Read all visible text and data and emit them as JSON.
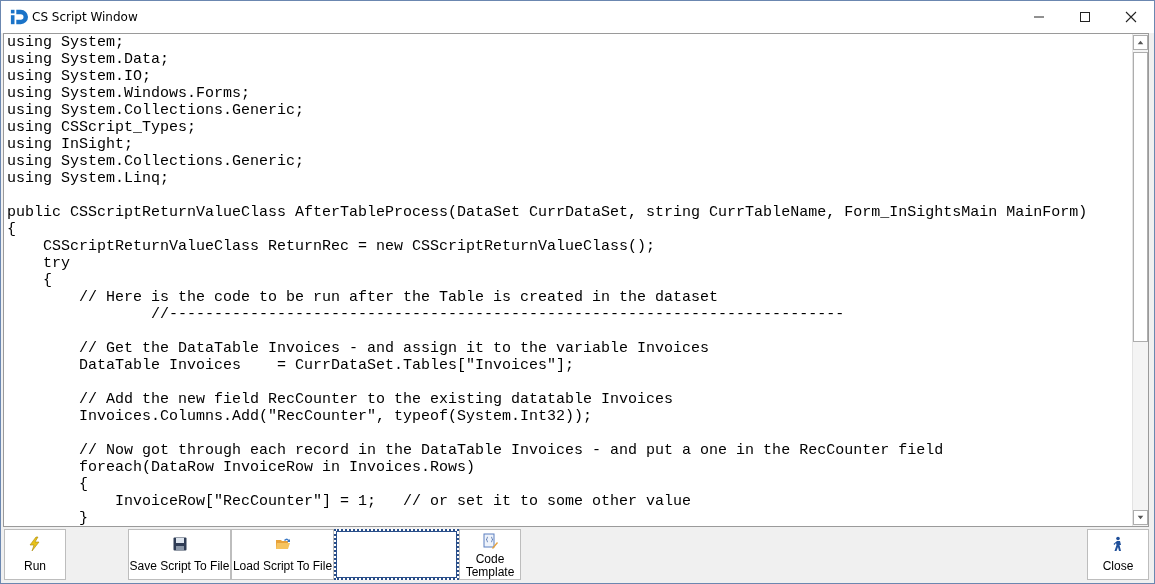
{
  "window": {
    "title": "CS Script Window"
  },
  "code_blocks": [
    [
      "using System;",
      "using System.Data;",
      "using System.IO;",
      "using System.Windows.Forms;",
      "using System.Collections.Generic;",
      "using CSScript_Types;",
      "using InSight;",
      "using System.Collections.Generic;",
      "using System.Linq;"
    ],
    [
      "public CSScriptReturnValueClass AfterTableProcess(DataSet CurrDataSet, string CurrTableName, Form_InSightsMain MainForm)",
      "{",
      "    CSScriptReturnValueClass ReturnRec = new CSScriptReturnValueClass();",
      "    try",
      "    {",
      "        // Here is the code to be run after the Table is created in the dataset",
      "                //---------------------------------------------------------------------------"
    ],
    [
      "        // Get the DataTable Invoices - and assign it to the variable Invoices",
      "        DataTable Invoices    = CurrDataSet.Tables[\"Invoices\"];"
    ],
    [
      "        // Add the new field RecCounter to the existing datatable Invoices",
      "        Invoices.Columns.Add(\"RecCounter\", typeof(System.Int32));"
    ],
    [
      "        // Now got through each record in the DataTable Invoices - and put a one in the RecCounter field",
      "        foreach(DataRow InvoiceRow in Invoices.Rows)",
      "        {",
      "            InvoiceRow[\"RecCounter\"] = 1;   // or set it to some other value",
      "        }"
    ]
  ],
  "toolbar": [
    {
      "kind": "run",
      "label": "Run",
      "focused": false
    },
    {
      "kind": "gap"
    },
    {
      "kind": "save",
      "label": "Save Script To File",
      "focused": false
    },
    {
      "kind": "load",
      "label": "Load Script To File",
      "focused": false
    },
    {
      "kind": "empty",
      "focused": true
    },
    {
      "kind": "template",
      "label": "Code Template",
      "focused": false
    },
    {
      "kind": "spacer"
    },
    {
      "kind": "close",
      "label": "Close",
      "focused": false
    }
  ]
}
